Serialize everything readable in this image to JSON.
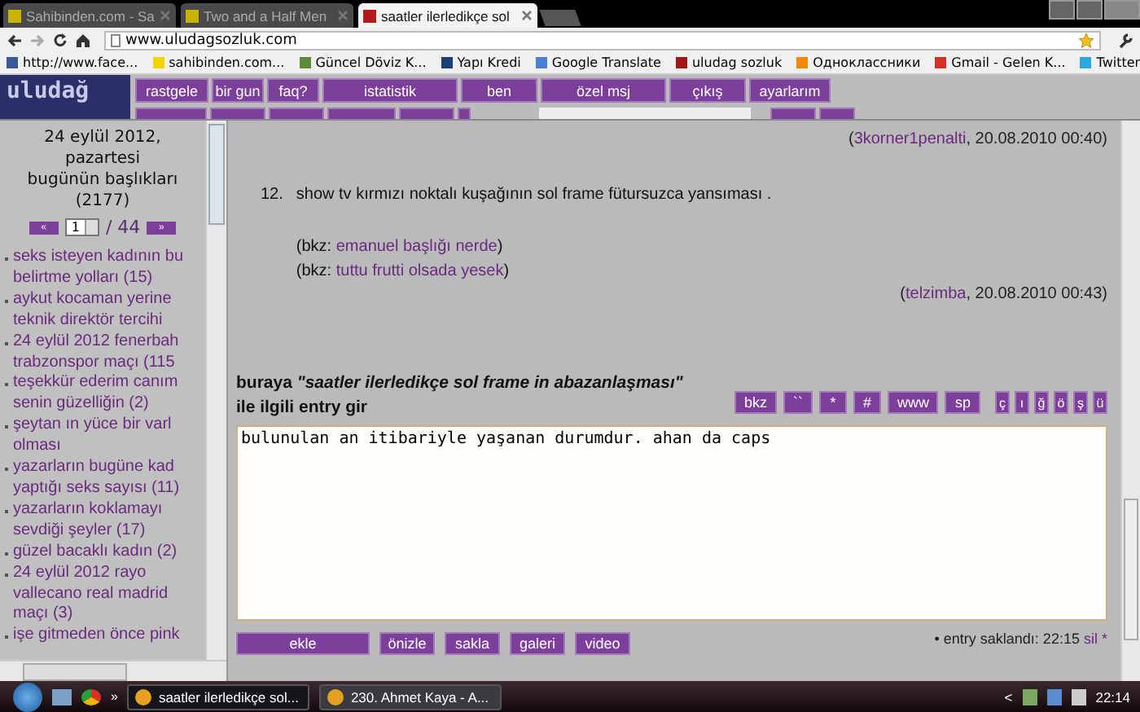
{
  "browser": {
    "tabs": [
      {
        "title": "Sahibinden.com - Sa",
        "selected": false
      },
      {
        "title": "Two and a Half Men",
        "selected": false
      },
      {
        "title": "saatler ilerledikçe sol",
        "selected": true
      }
    ],
    "address": "www.uludagsozluk.com",
    "bookmarks": [
      {
        "label": "http://www.face...",
        "color": "#3b5998"
      },
      {
        "label": "sahibinden.com...",
        "color": "#f2d500"
      },
      {
        "label": "Güncel Döviz K...",
        "color": "#5a8a3a"
      },
      {
        "label": "Yapı Kredi",
        "color": "#1a3f7a"
      },
      {
        "label": "Google Translate",
        "color": "#4a7fd4"
      },
      {
        "label": "uludag sozluk",
        "color": "#a01818"
      },
      {
        "label": "Одноклассники",
        "color": "#f08a00"
      },
      {
        "label": "Gmail - Gelen K...",
        "color": "#d93025"
      },
      {
        "label": "Twitter",
        "color": "#2aa9e0"
      }
    ]
  },
  "site": {
    "logo": "uludağ",
    "menu": [
      "rastgele",
      "bir gun",
      "faq?",
      "istatistik",
      "ben",
      "özel msj",
      "çıkış",
      "ayarlarım"
    ]
  },
  "sidebar": {
    "date": "24 eylül 2012,",
    "weekday": "pazartesi",
    "heading": "bugünün başlıkları",
    "count": "(2177)",
    "pager": {
      "prev": "«",
      "page": "1",
      "total": "/ 44",
      "next": "»"
    },
    "topics": [
      {
        "lines": [
          "seks isteyen kadının bu",
          "belirtme yolları (15)"
        ]
      },
      {
        "lines": [
          "aykut kocaman yerine",
          "teknik direktör tercihi"
        ]
      },
      {
        "lines": [
          "24 eylül 2012 fenerbah",
          "trabzonspor maçı (115"
        ]
      },
      {
        "lines": [
          "teşekkür ederim canım",
          "senin güzelliğin (2)"
        ]
      },
      {
        "lines": [
          "şeytan ın yüce bir varl",
          "olması"
        ]
      },
      {
        "lines": [
          "yazarların bugüne kad",
          "yaptığı seks sayısı (11)"
        ]
      },
      {
        "lines": [
          "yazarların koklamayı",
          "sevdiği şeyler (17)"
        ]
      },
      {
        "lines": [
          "güzel bacaklı kadın (2)"
        ]
      },
      {
        "lines": [
          "24 eylül 2012 rayo",
          "vallecano real madrid",
          "maçı (3)"
        ]
      },
      {
        "lines": [
          "işe gitmeden önce pink"
        ]
      }
    ]
  },
  "entries": [
    {
      "signature": {
        "open": "(",
        "author": "3korner1penalti",
        "date": ", 20.08.2010 00:40)"
      }
    },
    {
      "number": "12.",
      "text": "show tv kırmızı noktalı kuşağının sol frame fütursuzca yansıması .",
      "references": [
        {
          "prefix": "(bkz: ",
          "link": "emanuel başlığı nerde",
          "suffix": ")"
        },
        {
          "prefix": "(bkz: ",
          "link": "tuttu frutti olsada yesek",
          "suffix": ")"
        }
      ],
      "signature": {
        "open": "(",
        "author": "telzimba",
        "date": ", 20.08.2010 00:43)"
      }
    }
  ],
  "form": {
    "heading": "buraya *\"saatler ilerledikçe sol frame in abazanlaşması\"*",
    "heading_line2": "ile ilgili entry gir",
    "tools": [
      "bkz",
      "``",
      "*",
      "#",
      "www",
      "sp"
    ],
    "chars": [
      "ç",
      "ı",
      "ğ",
      "ö",
      "ş",
      "ü"
    ],
    "value": "bulunulan an itibariyle yaşanan durumdur. ahan da caps",
    "buttons": [
      {
        "label": "ekle",
        "kind": "wide"
      },
      {
        "label": "önizle",
        "kind": "normal"
      },
      {
        "label": "sakla",
        "kind": "normal"
      },
      {
        "label": "galeri",
        "kind": "normal"
      },
      {
        "label": "video",
        "kind": "normal"
      }
    ],
    "status": {
      "text": "• entry saklandı: 22:15",
      "link": "sil",
      "mark": "*"
    }
  },
  "taskbar": {
    "more": "»",
    "tasks": [
      {
        "label": "saatler ilerledikçe sol...",
        "selected": true
      },
      {
        "label": "230. Ahmet Kaya - A...",
        "selected": false
      }
    ],
    "tray_toggle": "<",
    "clock": "22:14"
  }
}
